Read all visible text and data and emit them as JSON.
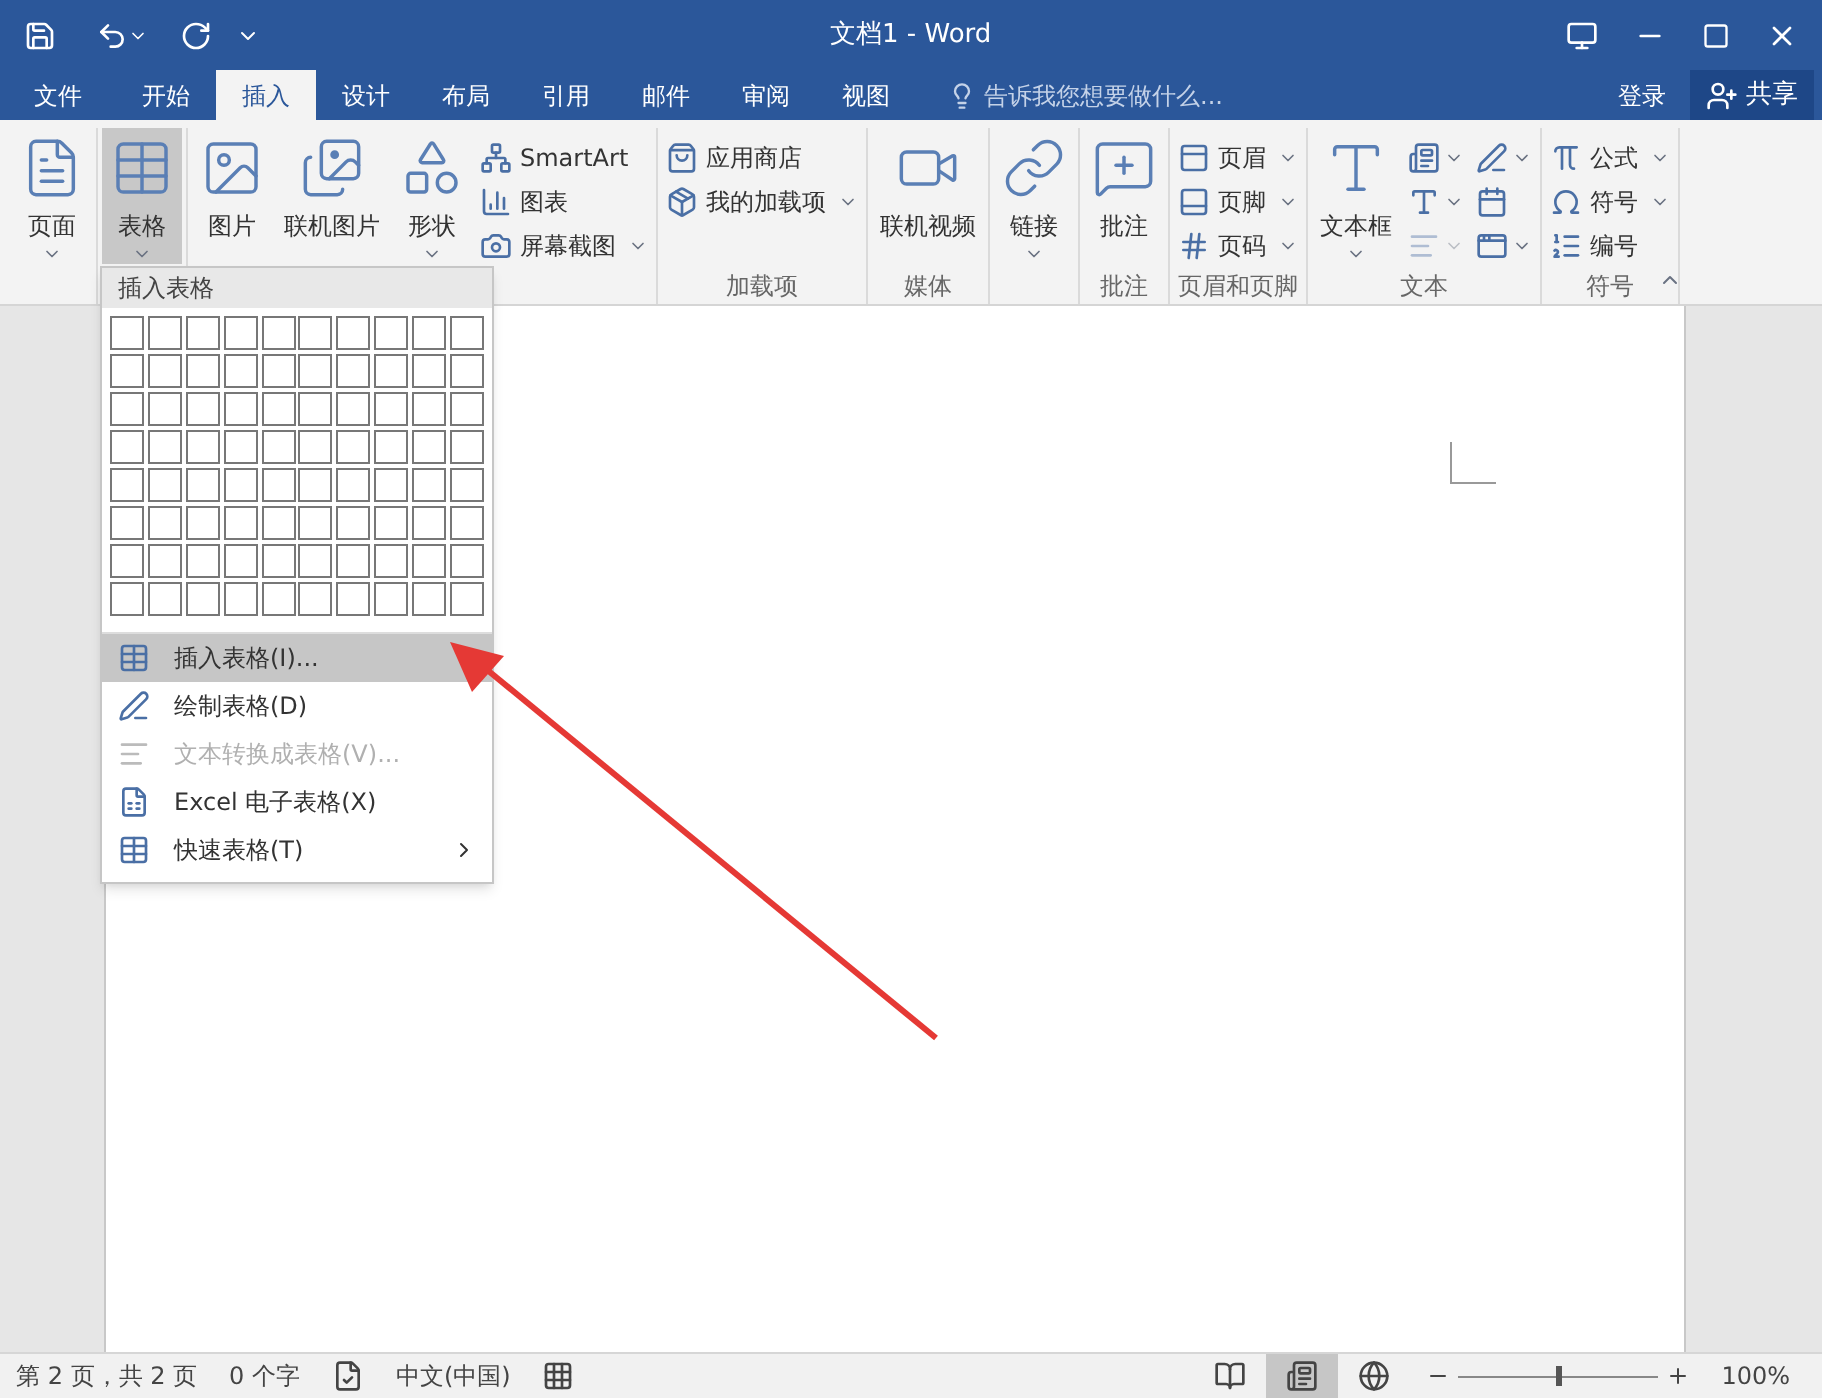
{
  "window": {
    "title": "文档1 - Word"
  },
  "tabs": [
    {
      "label": "文件",
      "selected": false,
      "kind": "file"
    },
    {
      "label": "开始",
      "selected": false
    },
    {
      "label": "插入",
      "selected": true
    },
    {
      "label": "设计",
      "selected": false
    },
    {
      "label": "布局",
      "selected": false
    },
    {
      "label": "引用",
      "selected": false
    },
    {
      "label": "邮件",
      "selected": false
    },
    {
      "label": "审阅",
      "selected": false
    },
    {
      "label": "视图",
      "selected": false
    }
  ],
  "tell_me": {
    "placeholder": "告诉我您想要做什么..."
  },
  "account": {
    "sign_in": "登录",
    "share": "共享"
  },
  "ribbon_groups": [
    {
      "controls": [
        {
          "kind": "large",
          "label": "页面",
          "dropdown": true,
          "pressed": false
        }
      ]
    },
    {
      "controls": [
        {
          "kind": "large",
          "label": "表格",
          "dropdown": true,
          "pressed": true
        }
      ]
    },
    {
      "controls": [
        {
          "kind": "large",
          "label": "图片",
          "dropdown": false,
          "pressed": false
        },
        {
          "kind": "large",
          "label": "联机图片",
          "dropdown": false,
          "pressed": false
        },
        {
          "kind": "large",
          "label": "形状",
          "dropdown": true,
          "pressed": false
        },
        {
          "kind": "small",
          "label": "SmartArt",
          "dropdown": false
        },
        {
          "kind": "small",
          "label": "图表",
          "dropdown": false
        },
        {
          "kind": "small",
          "label": "屏幕截图",
          "dropdown": true
        }
      ]
    },
    {
      "caption": "加载项",
      "controls": [
        {
          "kind": "small",
          "label": "应用商店",
          "dropdown": false
        },
        {
          "kind": "small",
          "label": "我的加载项",
          "dropdown": true
        }
      ]
    },
    {
      "caption": "媒体",
      "controls": [
        {
          "kind": "large",
          "label": "联机视频",
          "dropdown": false,
          "pressed": false
        }
      ]
    },
    {
      "controls": [
        {
          "kind": "large",
          "label": "链接",
          "dropdown": true,
          "pressed": false
        }
      ]
    },
    {
      "caption": "批注",
      "controls": [
        {
          "kind": "large",
          "label": "批注",
          "dropdown": false,
          "pressed": false
        }
      ]
    },
    {
      "caption": "页眉和页脚",
      "controls": [
        {
          "kind": "small",
          "label": "页眉",
          "dropdown": true
        },
        {
          "kind": "small",
          "label": "页脚",
          "dropdown": true
        },
        {
          "kind": "small",
          "label": "页码",
          "dropdown": true
        }
      ]
    },
    {
      "caption": "文本",
      "controls": [
        {
          "kind": "large",
          "label": "文本框",
          "dropdown": true,
          "pressed": false
        },
        {
          "kind": "icon",
          "dropdown": true,
          "disabled": false
        },
        {
          "kind": "icon",
          "dropdown": true,
          "disabled": false
        },
        {
          "kind": "icon",
          "dropdown": true,
          "disabled": true
        },
        {
          "kind": "icon",
          "dropdown": true,
          "disabled": false
        },
        {
          "kind": "icon",
          "dropdown": false,
          "disabled": false
        },
        {
          "kind": "icon",
          "dropdown": true,
          "disabled": false
        }
      ]
    },
    {
      "caption": "符号",
      "controls": [
        {
          "kind": "small",
          "label": "公式",
          "dropdown": true
        },
        {
          "kind": "small",
          "label": "符号",
          "dropdown": true
        },
        {
          "kind": "small",
          "label": "编号",
          "dropdown": false
        }
      ]
    }
  ],
  "table_menu": {
    "header": "插入表格",
    "items": [
      {
        "label": "插入表格(I)...",
        "highlighted": true,
        "disabled": false,
        "submenu": false
      },
      {
        "label": "绘制表格(D)",
        "highlighted": false,
        "disabled": false,
        "submenu": false
      },
      {
        "label": "文本转换成表格(V)...",
        "highlighted": false,
        "disabled": true,
        "submenu": false
      },
      {
        "label": "Excel 电子表格(X)",
        "highlighted": false,
        "disabled": false,
        "submenu": false
      },
      {
        "label": "快速表格(T)",
        "highlighted": false,
        "disabled": false,
        "submenu": true
      }
    ]
  },
  "status_bar": {
    "page": "第 2 页，共 2 页",
    "words": "0 个字",
    "language": "中文(中国)",
    "views": [
      {
        "selected": false
      },
      {
        "selected": true
      },
      {
        "selected": false
      }
    ],
    "zoom": {
      "level": 0.5,
      "reading": "100%"
    }
  }
}
